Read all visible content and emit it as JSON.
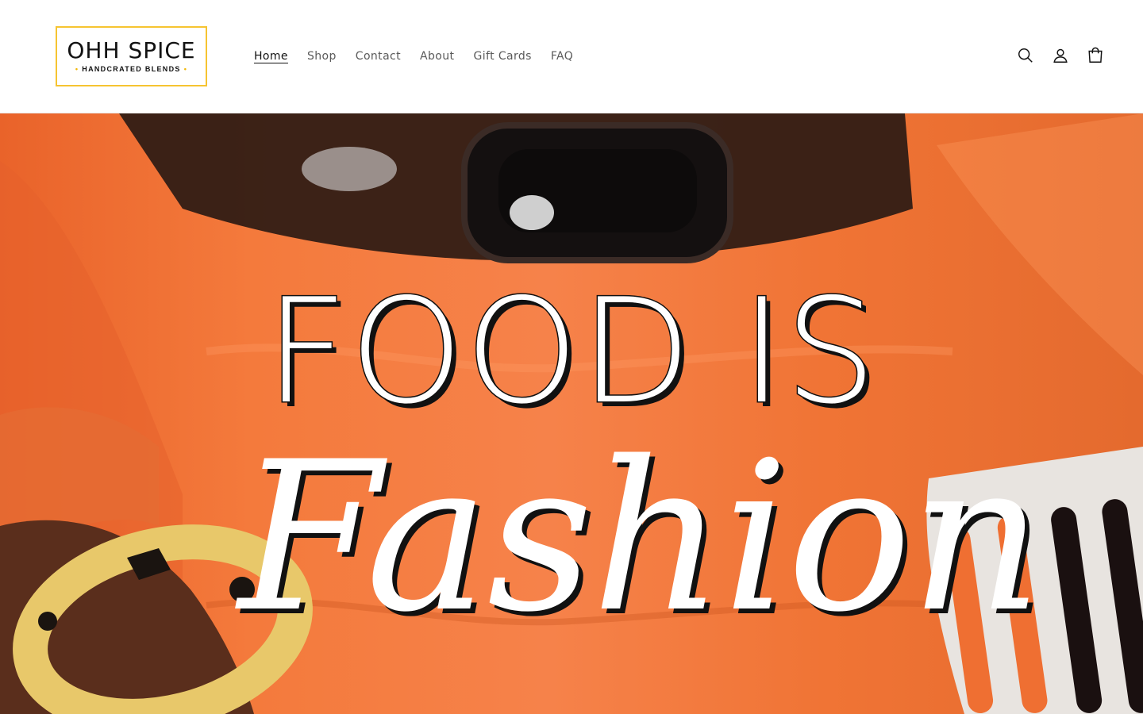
{
  "brand": {
    "name": "OHH SPICE",
    "tagline": "HANDCRATED BLENDS",
    "accent_color": "#f6c431"
  },
  "nav": {
    "items": [
      {
        "label": "Home",
        "active": true
      },
      {
        "label": "Shop",
        "active": false
      },
      {
        "label": "Contact",
        "active": false
      },
      {
        "label": "About",
        "active": false
      },
      {
        "label": "Gift Cards",
        "active": false
      },
      {
        "label": "FAQ",
        "active": false
      }
    ]
  },
  "header_icons": [
    "search-icon",
    "account-icon",
    "cart-icon"
  ],
  "hero": {
    "line1": "FOOD IS",
    "line2": "Fashion",
    "background_color": "#f47a3c"
  }
}
